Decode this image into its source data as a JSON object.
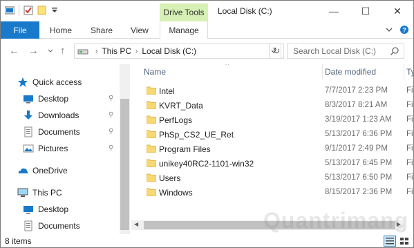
{
  "titlebar": {
    "contextual_tab": "Drive Tools",
    "title": "Local Disk (C:)",
    "minimize": "—",
    "maximize": "☐",
    "close": "✕"
  },
  "ribbon": {
    "tabs": [
      "File",
      "Home",
      "Share",
      "View",
      "Manage"
    ],
    "collapse_icon": "chevron-down-icon",
    "help_icon": "help-icon"
  },
  "address": {
    "crumbs": [
      "This PC",
      "Local Disk (C:)"
    ],
    "search_placeholder": "Search Local Disk (C:)"
  },
  "nav": {
    "items": [
      {
        "label": "Quick access",
        "icon": "star-icon",
        "pinned": false
      },
      {
        "label": "Desktop",
        "icon": "desktop-icon",
        "pinned": true
      },
      {
        "label": "Downloads",
        "icon": "download-icon",
        "pinned": true
      },
      {
        "label": "Documents",
        "icon": "documents-icon",
        "pinned": true
      },
      {
        "label": "Pictures",
        "icon": "pictures-icon",
        "pinned": true
      },
      {
        "label": "OneDrive",
        "icon": "onedrive-icon",
        "pinned": false
      },
      {
        "label": "This PC",
        "icon": "computer-icon",
        "pinned": false
      },
      {
        "label": "Desktop",
        "icon": "desktop-icon",
        "pinned": false
      },
      {
        "label": "Documents",
        "icon": "documents-icon",
        "pinned": false
      }
    ]
  },
  "columns": {
    "name": "Name",
    "date": "Date modified",
    "type": "Ty"
  },
  "files": [
    {
      "name": "Intel",
      "date": "7/7/2017 2:23 PM",
      "type": "Fi"
    },
    {
      "name": "KVRT_Data",
      "date": "8/3/2017 8:21 AM",
      "type": "Fi"
    },
    {
      "name": "PerfLogs",
      "date": "3/19/2017 1:23 AM",
      "type": "Fi"
    },
    {
      "name": "PhSp_CS2_UE_Ret",
      "date": "5/13/2017 6:36 PM",
      "type": "Fi"
    },
    {
      "name": "Program Files",
      "date": "9/1/2017 2:49 PM",
      "type": "Fi"
    },
    {
      "name": "unikey40RC2-1101-win32",
      "date": "5/13/2017 6:45 PM",
      "type": "Fi"
    },
    {
      "name": "Users",
      "date": "5/13/2017 6:50 PM",
      "type": "Fi"
    },
    {
      "name": "Windows",
      "date": "8/15/2017 2:36 PM",
      "type": "Fi"
    }
  ],
  "status": {
    "item_count": "8 items"
  },
  "colors": {
    "file_tab": "#1979ca",
    "drive_tools": "#d7f0b5",
    "folder": "#f8d775",
    "accent": "#0078d7"
  },
  "watermark": "Quantrimang"
}
